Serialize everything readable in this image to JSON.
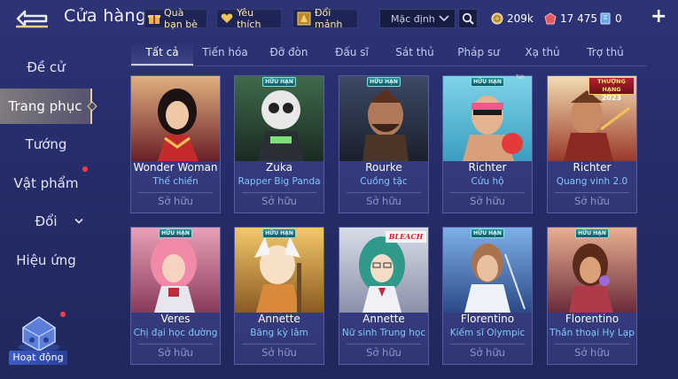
{
  "header": {
    "title": "Cửa hàng",
    "buttons": {
      "friend_gift": "Quà bạn bè",
      "favorite": "Yêu thích",
      "exchange": "Đổi mảnh"
    },
    "sort": {
      "selected": "Mặc định"
    },
    "currencies": {
      "gold": "209k",
      "gems": "17 475",
      "vouchers": "0"
    }
  },
  "tabs": [
    "Tất cả",
    "Tiến hóa",
    "Đỡ đòn",
    "Đấu sĩ",
    "Sát thủ",
    "Pháp sư",
    "Xạ thủ",
    "Trợ thủ"
  ],
  "sidebar": {
    "items": [
      "Đề cử",
      "Trang phục",
      "Tướng",
      "Vật phẩm",
      "Đổi",
      "Hiệu ứng"
    ],
    "event_label": "Hoạt động"
  },
  "cards": [
    {
      "hero": "Wonder Woman",
      "skin": "Thế chiến",
      "status": "Sở hữu",
      "badge": ""
    },
    {
      "hero": "Zuka",
      "skin": "Rapper Big Panda",
      "status": "Sở hữu",
      "badge": "HỮU HẠN"
    },
    {
      "hero": "Rourke",
      "skin": "Cuồng tặc",
      "status": "Sở hữu",
      "badge": "HỮU HẠN"
    },
    {
      "hero": "Richter",
      "skin": "Cứu hộ",
      "status": "Sở hữu",
      "badge": "HỮU HẠN",
      "tag": "Tab"
    },
    {
      "hero": "Richter",
      "skin": "Quang vinh 2.0",
      "status": "Sở hữu",
      "badge_gold_line1": "THƯỢNG HẠNG",
      "badge_gold_line2": "2023"
    },
    {
      "hero": "Veres",
      "skin": "Chị đại học đường",
      "status": "Sở hữu",
      "badge": "HỮU HẠN"
    },
    {
      "hero": "Annette",
      "skin": "Băng kỳ lâm",
      "status": "Sở hữu",
      "badge": "HỮU HẠN"
    },
    {
      "hero": "Annette",
      "skin": "Nữ sinh Trung học",
      "status": "Sở hữu",
      "logo_text": "BLEACH"
    },
    {
      "hero": "Florentino",
      "skin": "Kiếm sĩ Olympic",
      "status": "Sở hữu",
      "badge": "HỮU HẠN"
    },
    {
      "hero": "Florentino",
      "skin": "Thần thoại Hy Lạp",
      "status": "Sở hữu",
      "badge": "HỮU HẠN"
    }
  ],
  "colors": {
    "background": "#252c68",
    "card": "#373d80",
    "skin_name": "#7fc8ff",
    "owned": "#8f95c4",
    "active_side": "#c8b98c",
    "gold": "#e8cf86"
  }
}
